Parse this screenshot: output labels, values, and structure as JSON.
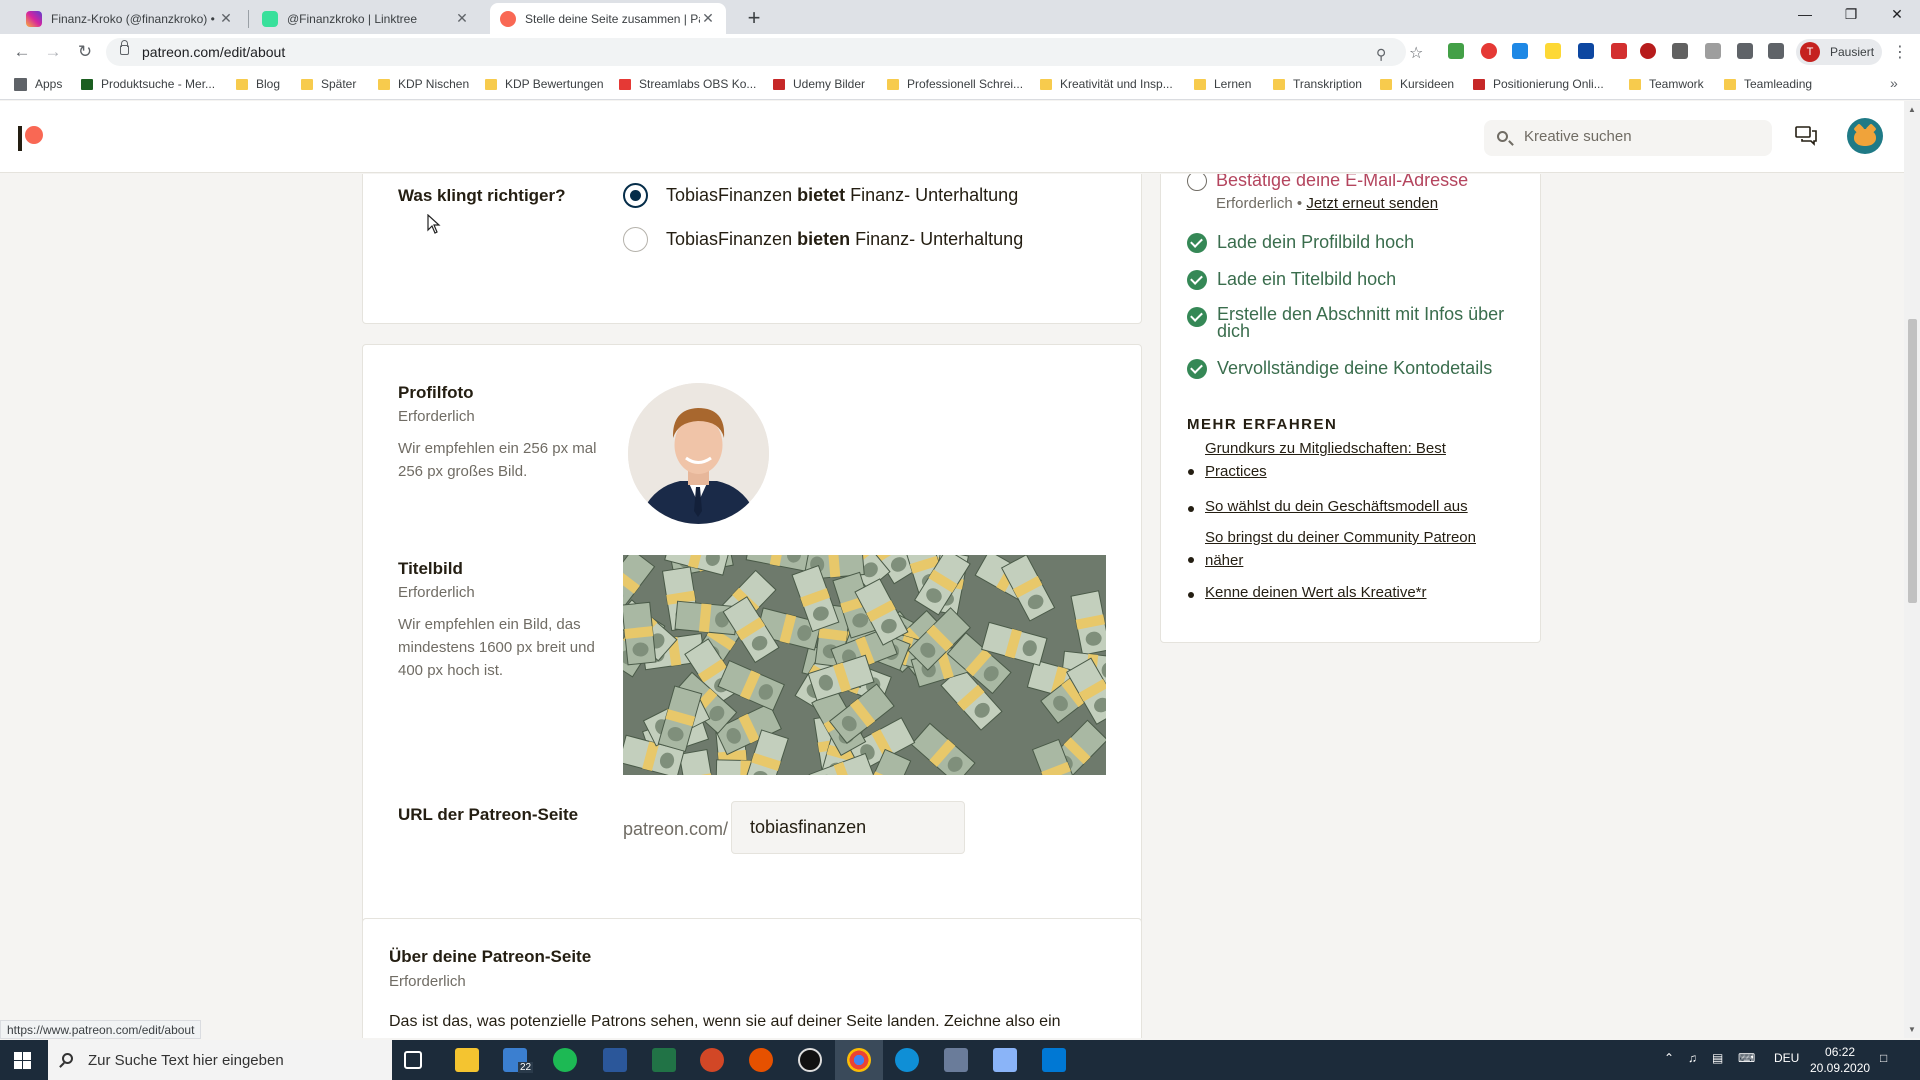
{
  "browser": {
    "tabs": [
      {
        "title": "Finanz-Kroko (@finanzkroko) • In",
        "close": "✕",
        "color": "#d6249f"
      },
      {
        "title": "@Finanzkroko | Linktree",
        "close": "✕",
        "color": "#39e09b"
      },
      {
        "title": "Stelle deine Seite zusammen | Pa",
        "close": "✕",
        "color": "#f96854"
      }
    ],
    "new_tab": "+",
    "window_controls": [
      "—",
      "❐",
      "✕"
    ],
    "url": "patreon.com/edit/about",
    "profile_initial": "T",
    "profile_status": "Pausiert",
    "bookmarks": [
      {
        "label": "Apps",
        "icon": "apps-grid-icon"
      },
      {
        "label": "Produktsuche - Mer...",
        "icon": "merch-icon"
      },
      {
        "label": "Blog",
        "icon": "folder-icon"
      },
      {
        "label": "Später",
        "icon": "folder-icon"
      },
      {
        "label": "KDP Nischen",
        "icon": "folder-icon"
      },
      {
        "label": "KDP Bewertungen",
        "icon": "folder-icon"
      },
      {
        "label": "Streamlabs OBS Ko...",
        "icon": "youtube-icon"
      },
      {
        "label": "Udemy Bilder",
        "icon": "udemy-icon"
      },
      {
        "label": "Professionell Schrei...",
        "icon": "folder-icon"
      },
      {
        "label": "Kreativität und Insp...",
        "icon": "folder-icon"
      },
      {
        "label": "Lernen",
        "icon": "folder-icon"
      },
      {
        "label": "Transkription",
        "icon": "folder-icon"
      },
      {
        "label": "Kursideen",
        "icon": "folder-icon"
      },
      {
        "label": "Positionierung Onli...",
        "icon": "udemy-icon"
      },
      {
        "label": "Teamwork",
        "icon": "folder-icon"
      },
      {
        "label": "Teamleading",
        "icon": "folder-icon"
      }
    ],
    "bookmarks_more": "»",
    "status_url": "https://www.patreon.com/edit/about"
  },
  "header": {
    "search_placeholder": "Kreative suchen"
  },
  "form": {
    "question": {
      "label": "Was klingt richtiger?",
      "options": [
        {
          "prefix": "TobiasFinanzen ",
          "bold": "bietet",
          "suffix": " Finanz- Unterhaltung",
          "selected": true
        },
        {
          "prefix": "TobiasFinanzen ",
          "bold": "bieten",
          "suffix": " Finanz- Unterhaltung",
          "selected": false
        }
      ]
    },
    "profile_photo": {
      "label": "Profilfoto",
      "required": "Erforderlich",
      "help": "Wir empfehlen ein 256 px mal 256 px großes Bild."
    },
    "cover": {
      "label": "Titelbild",
      "required": "Erforderlich",
      "help": "Wir empfehlen ein Bild, das mindestens 1600 px breit und 400 px hoch ist."
    },
    "url": {
      "label": "URL der Patreon-Seite",
      "prefix": "patreon.com/",
      "value": "tobiasfinanzen"
    },
    "about": {
      "label": "Über deine Patreon-Seite",
      "required": "Erforderlich",
      "help_partial": "Das ist das, was potenzielle Patrons sehen, wenn sie auf deiner Seite landen. Zeichne also ein"
    }
  },
  "checklist": {
    "pending": {
      "label": "Bestätige deine E-Mail-Adresse",
      "required": "Erforderlich",
      "separator": "•",
      "resend": "Jetzt erneut senden"
    },
    "done": [
      "Lade dein Profilbild hoch",
      "Lade ein Titelbild hoch",
      "Erstelle den Abschnitt mit Infos über dich",
      "Vervollständige deine Kontodetails"
    ],
    "learn_more": "MEHR ERFAHREN",
    "links": [
      "Grundkurs zu Mitgliedschaften: Best Practices",
      "So wählst du dein Geschäftsmodell aus",
      "So bringst du deiner Community Patreon näher",
      "Kenne deinen Wert als Kreative*r"
    ]
  },
  "taskbar": {
    "search_placeholder": "Zur Suche Text hier eingeben",
    "mail_badge": "22",
    "language": "DEU",
    "time": "06:22",
    "date": "20.09.2020"
  }
}
